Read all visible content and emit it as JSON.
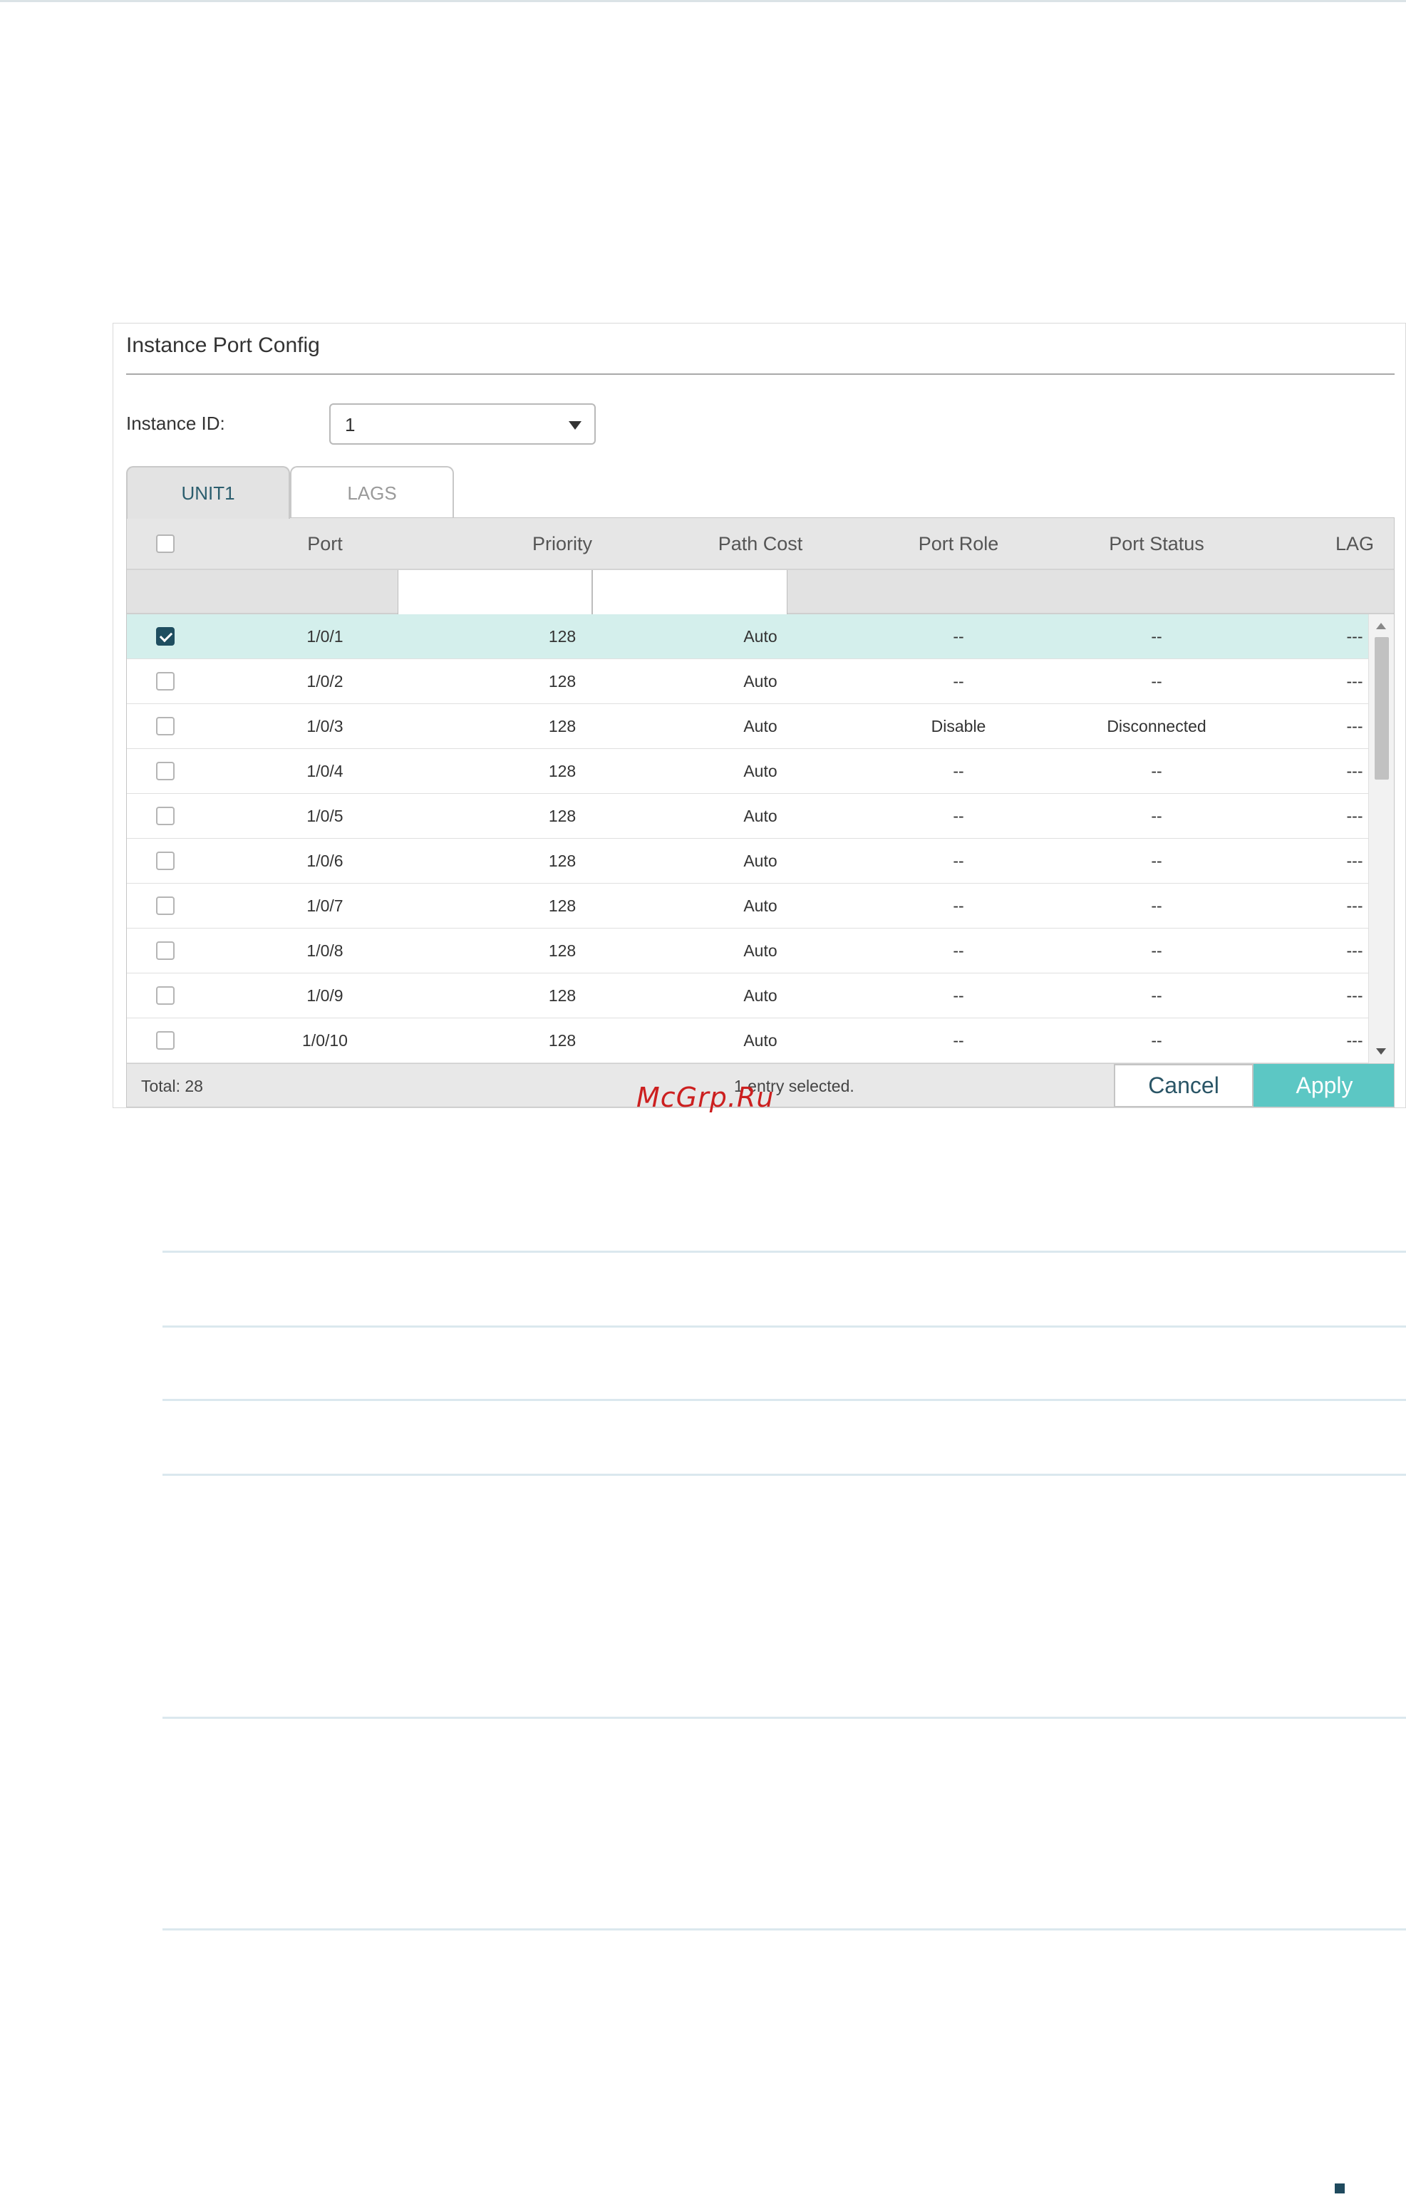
{
  "panel": {
    "title": "Instance Port Config"
  },
  "instance": {
    "label": "Instance ID:",
    "value": "1"
  },
  "tabs": [
    {
      "label": "UNIT1",
      "active": true
    },
    {
      "label": "LAGS",
      "active": false
    }
  ],
  "table": {
    "columns": [
      "Port",
      "Priority",
      "Path Cost",
      "Port Role",
      "Port Status",
      "LAG"
    ],
    "rows": [
      {
        "checked": true,
        "port": "1/0/1",
        "priority": "128",
        "path_cost": "Auto",
        "role": "--",
        "status": "--",
        "lag": "---"
      },
      {
        "checked": false,
        "port": "1/0/2",
        "priority": "128",
        "path_cost": "Auto",
        "role": "--",
        "status": "--",
        "lag": "---"
      },
      {
        "checked": false,
        "port": "1/0/3",
        "priority": "128",
        "path_cost": "Auto",
        "role": "Disable",
        "status": "Disconnected",
        "lag": "---"
      },
      {
        "checked": false,
        "port": "1/0/4",
        "priority": "128",
        "path_cost": "Auto",
        "role": "--",
        "status": "--",
        "lag": "---"
      },
      {
        "checked": false,
        "port": "1/0/5",
        "priority": "128",
        "path_cost": "Auto",
        "role": "--",
        "status": "--",
        "lag": "---"
      },
      {
        "checked": false,
        "port": "1/0/6",
        "priority": "128",
        "path_cost": "Auto",
        "role": "--",
        "status": "--",
        "lag": "---"
      },
      {
        "checked": false,
        "port": "1/0/7",
        "priority": "128",
        "path_cost": "Auto",
        "role": "--",
        "status": "--",
        "lag": "---"
      },
      {
        "checked": false,
        "port": "1/0/8",
        "priority": "128",
        "path_cost": "Auto",
        "role": "--",
        "status": "--",
        "lag": "---"
      },
      {
        "checked": false,
        "port": "1/0/9",
        "priority": "128",
        "path_cost": "Auto",
        "role": "--",
        "status": "--",
        "lag": "---"
      },
      {
        "checked": false,
        "port": "1/0/10",
        "priority": "128",
        "path_cost": "Auto",
        "role": "--",
        "status": "--",
        "lag": "---"
      }
    ]
  },
  "footer": {
    "total": "Total: 28",
    "selected": "1 entry selected.",
    "cancel_label": "Cancel",
    "apply_label": "Apply"
  },
  "watermark": "McGrp.Ru",
  "colors": {
    "accent": "#5cc7c4",
    "selected_row": "#d4efec",
    "checkbox_checked": "#1f4e60",
    "watermark": "#cc1f1f"
  },
  "icons": {
    "select_caret": "caret-down-icon",
    "scroll_up": "arrow-up-icon",
    "scroll_down": "arrow-down-icon",
    "checkmark": "check-icon"
  }
}
